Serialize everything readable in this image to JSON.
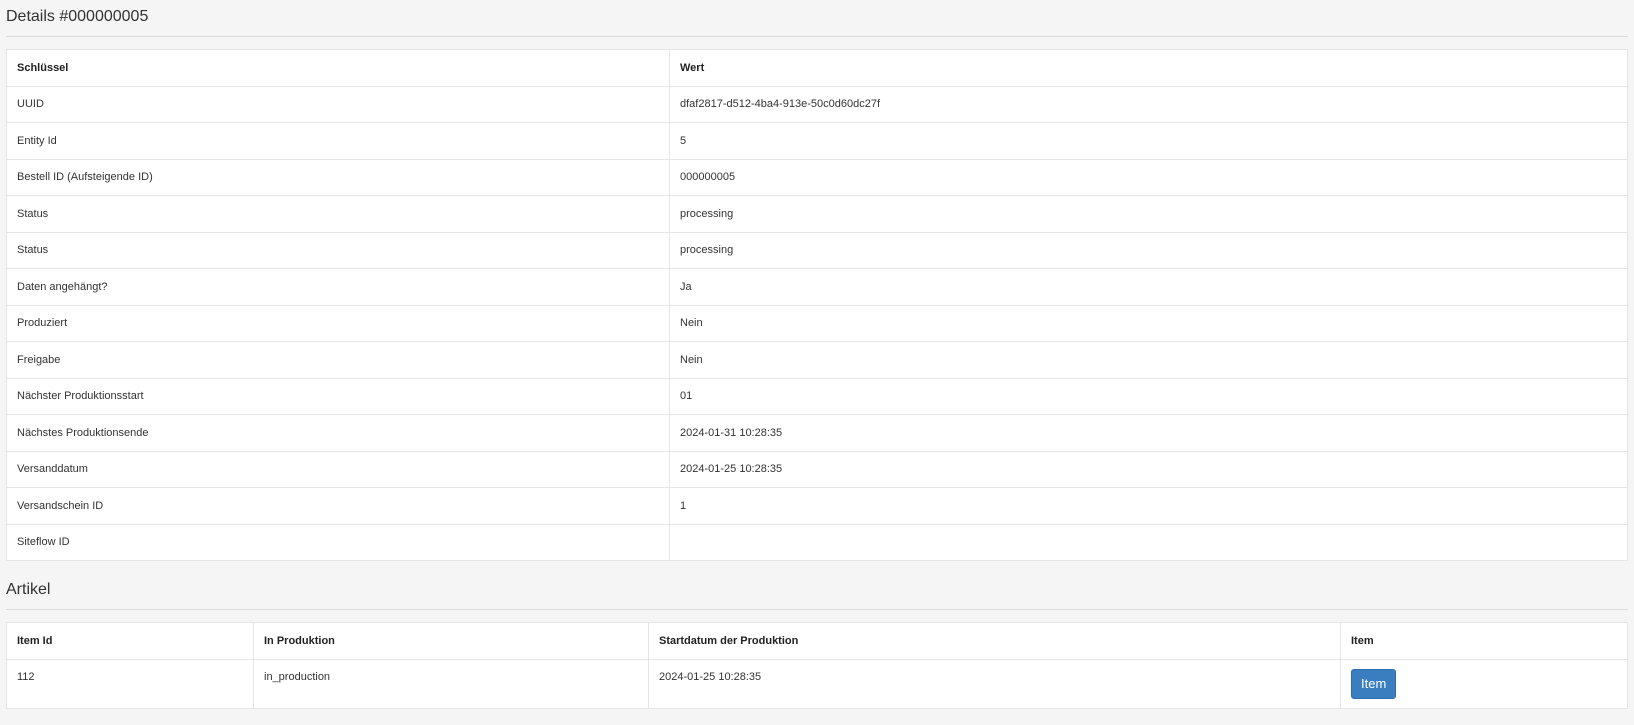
{
  "details": {
    "title": "Details #000000005",
    "headers": {
      "key": "Schlüssel",
      "value": "Wert"
    },
    "rows": [
      {
        "key": "UUID",
        "value": "dfaf2817-d512-4ba4-913e-50c0d60dc27f"
      },
      {
        "key": "Entity Id",
        "value": "5"
      },
      {
        "key": "Bestell ID (Aufsteigende ID)",
        "value": "000000005"
      },
      {
        "key": "Status",
        "value": "processing"
      },
      {
        "key": "Status",
        "value": "processing"
      },
      {
        "key": "Daten angehängt?",
        "value": "Ja"
      },
      {
        "key": "Produziert",
        "value": "Nein"
      },
      {
        "key": "Freigabe",
        "value": "Nein"
      },
      {
        "key": "Nächster Produktionsstart",
        "value": "01"
      },
      {
        "key": "Nächstes Produktionsende",
        "value": "2024-01-31 10:28:35"
      },
      {
        "key": "Versanddatum",
        "value": "2024-01-25 10:28:35"
      },
      {
        "key": "Versandschein ID",
        "value": "1"
      },
      {
        "key": "Siteflow ID",
        "value": ""
      }
    ]
  },
  "artikel": {
    "title": "Artikel",
    "headers": {
      "item_id": "Item Id",
      "in_produktion": "In Produktion",
      "startdatum": "Startdatum der Produktion",
      "item": "Item"
    },
    "rows": [
      {
        "item_id": "112",
        "in_produktion": "in_production",
        "startdatum": "2024-01-25 10:28:35",
        "item_button_label": "Item"
      }
    ]
  },
  "colors": {
    "page_background": "#f5f5f5",
    "button_primary": "#3a7ebf"
  }
}
